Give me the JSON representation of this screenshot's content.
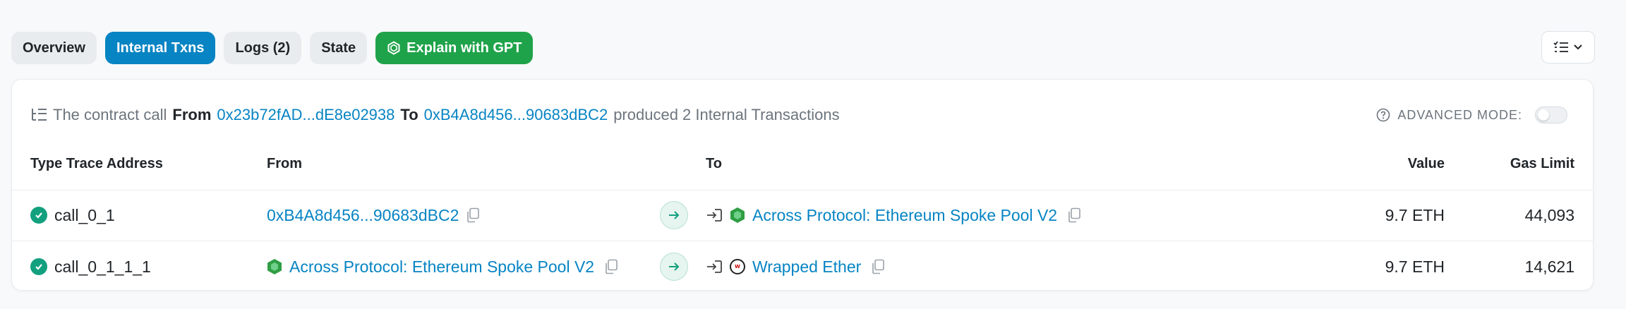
{
  "tabs": [
    {
      "label": "Overview"
    },
    {
      "label": "Internal Txns"
    },
    {
      "label": "Logs (2)"
    },
    {
      "label": "State"
    }
  ],
  "gpt_button": {
    "label": "Explain with GPT"
  },
  "summary": {
    "prefix": "The contract call",
    "from_word": "From",
    "from_address": "0x23b72fAD...dE8e02938",
    "to_word": "To",
    "to_address": "0xB4A8d456...90683dBC2",
    "suffix": "produced 2 Internal Transactions"
  },
  "advanced_mode": {
    "label": "ADVANCED MODE:",
    "enabled": false
  },
  "table": {
    "headers": {
      "type": "Type Trace Address",
      "from": "From",
      "to": "To",
      "value": "Value",
      "gas": "Gas Limit"
    },
    "rows": [
      {
        "trace": "call_0_1",
        "from": "0xB4A8d456...90683dBC2",
        "from_icon": "",
        "to": "Across Protocol: Ethereum Spoke Pool V2",
        "to_icon": "across-protocol",
        "value": "9.7 ETH",
        "gas": "44,093"
      },
      {
        "trace": "call_0_1_1_1",
        "from": "Across Protocol: Ethereum Spoke Pool V2",
        "from_icon": "across-protocol",
        "to": "Wrapped Ether",
        "to_icon": "weth",
        "value": "9.7 ETH",
        "gas": "14,621"
      }
    ]
  },
  "colors": {
    "accent": "#0784c3",
    "gpt": "#1fa34a",
    "success": "#13a07e"
  }
}
